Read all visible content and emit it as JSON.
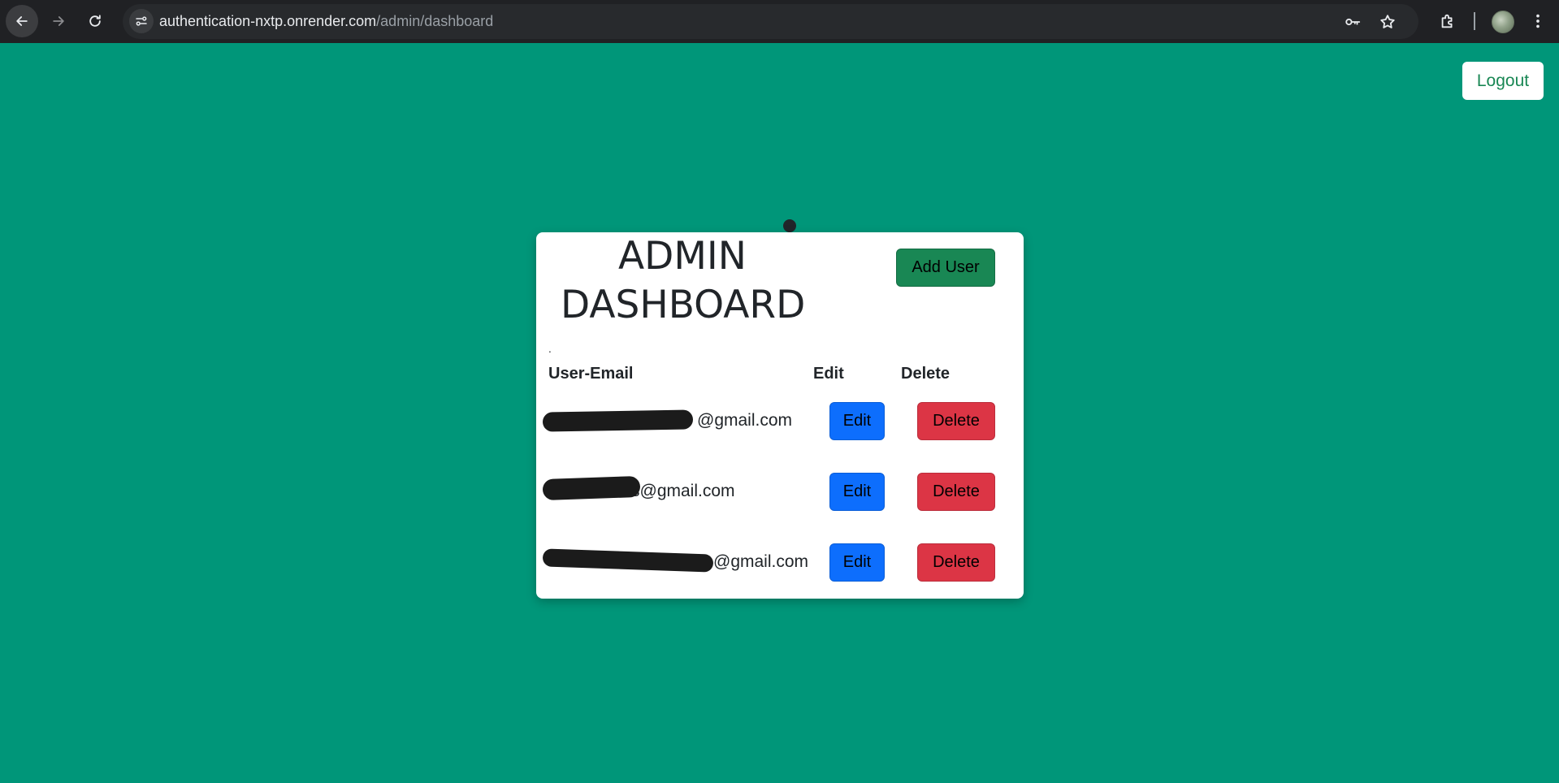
{
  "browser": {
    "url_host": "authentication-nxtp.onrender.com",
    "url_path": "/admin/dashboard"
  },
  "header": {
    "logout_label": "Logout"
  },
  "card": {
    "title_line1": "ADMIN",
    "title_line2": "DASHBOARD",
    "add_user_label": "Add User",
    "stray_mark": ".",
    "columns": {
      "email": "User-Email",
      "edit": "Edit",
      "delete": "Delete"
    },
    "users": [
      {
        "email": "@gmail.com",
        "edit_label": "Edit",
        "delete_label": "Delete"
      },
      {
        "email": "s@gmail.com",
        "edit_label": "Edit",
        "delete_label": "Delete"
      },
      {
        "email": "@gmail.com",
        "edit_label": "Edit",
        "delete_label": "Delete"
      }
    ]
  },
  "colors": {
    "page_background": "#009679",
    "edit_button": "#0d6efd",
    "delete_button": "#dc3545",
    "add_user_button": "#198754"
  },
  "icons": [
    "back-arrow-icon",
    "forward-arrow-icon",
    "reload-icon",
    "site-info-icon",
    "key-icon",
    "star-icon",
    "extensions-icon",
    "avatar",
    "more-menu-icon"
  ]
}
